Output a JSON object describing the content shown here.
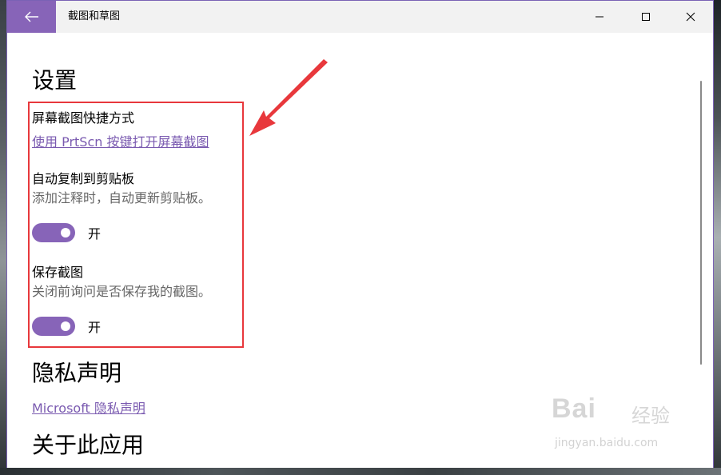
{
  "window": {
    "title": "截图和草图"
  },
  "settings": {
    "heading": "设置",
    "shortcut": {
      "label": "屏幕截图快捷方式",
      "link": "使用 PrtScn 按键打开屏幕截图"
    },
    "clipboard": {
      "label": "自动复制到剪贴板",
      "description": "添加注释时，自动更新剪贴板。",
      "toggle_state": "开",
      "toggle_on": true
    },
    "save": {
      "label": "保存截图",
      "description": "关闭前询问是否保存我的截图。",
      "toggle_state": "开",
      "toggle_on": true
    }
  },
  "privacy": {
    "heading": "隐私声明",
    "link": "Microsoft 隐私声明"
  },
  "about": {
    "heading": "关于此应用"
  },
  "watermark": {
    "brand": "Bai",
    "brand_cn": "经验",
    "url": "jingyan.baidu.com"
  },
  "colors": {
    "accent": "#8764b8",
    "link": "#7a5ab0",
    "annotation": "#e8383c"
  }
}
